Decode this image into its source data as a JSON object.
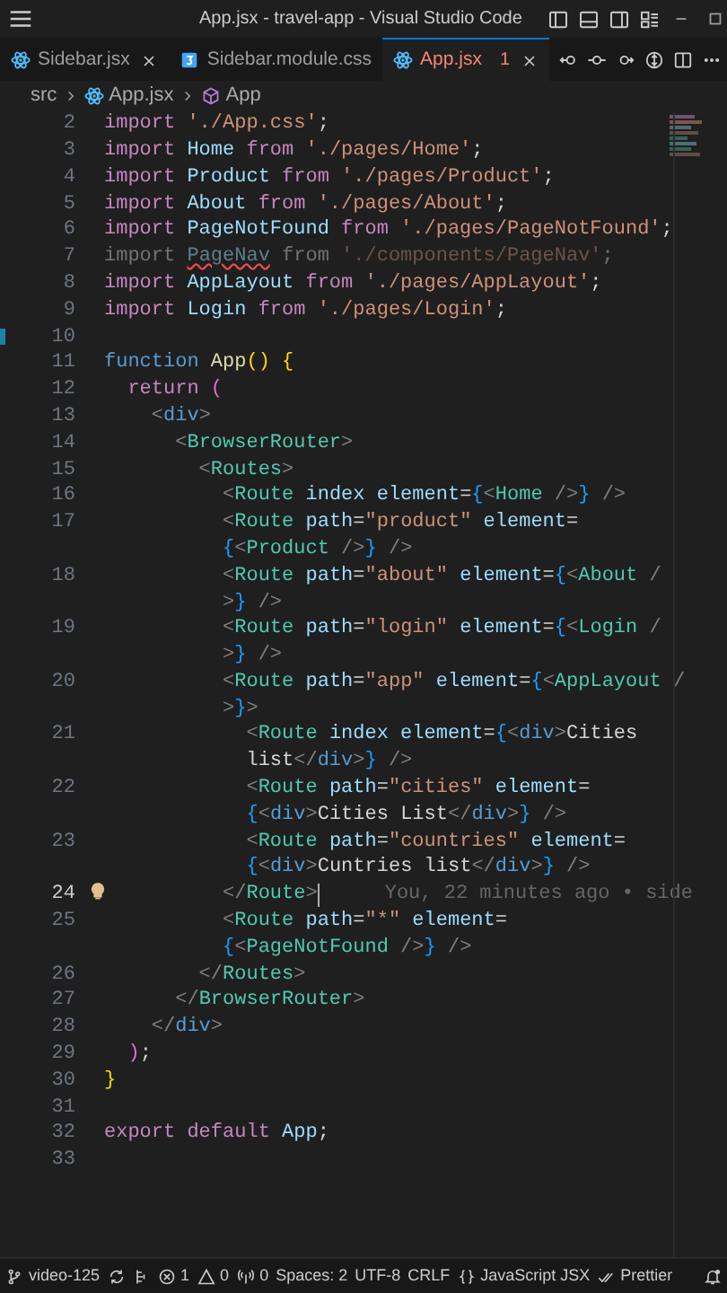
{
  "window": {
    "title": "App.jsx - travel-app - Visual Studio Code"
  },
  "tabs": [
    {
      "label": "Sidebar.jsx",
      "kind": "react",
      "selected": false,
      "close_shown": true
    },
    {
      "label": "Sidebar.module.css",
      "kind": "css",
      "selected": false,
      "close_shown": false
    },
    {
      "label": "App.jsx",
      "kind": "react",
      "selected": true,
      "close_shown": true,
      "problems": "1"
    }
  ],
  "breadcrumb": [
    {
      "label": "src",
      "kind": "folder"
    },
    {
      "label": "App.jsx",
      "kind": "react"
    },
    {
      "label": "App",
      "kind": "symbol"
    }
  ],
  "rows": [
    {
      "number": "2",
      "current": false,
      "changed": false,
      "tokens": [
        {
          "kind": "kw",
          "text": "import"
        },
        {
          "kind": "str",
          "text": " './App.css'"
        },
        {
          "kind": "plain",
          "text": ";"
        }
      ]
    },
    {
      "number": "3",
      "current": false,
      "changed": false,
      "tokens": [
        {
          "kind": "kw",
          "text": "import"
        },
        {
          "kind": "id",
          "text": " Home"
        },
        {
          "kind": "kw",
          "text": " from"
        },
        {
          "kind": "str",
          "text": " './pages/Home'"
        },
        {
          "kind": "plain",
          "text": ";"
        }
      ]
    },
    {
      "number": "4",
      "current": false,
      "changed": false,
      "tokens": [
        {
          "kind": "kw",
          "text": "import"
        },
        {
          "kind": "id",
          "text": " Product"
        },
        {
          "kind": "kw",
          "text": " from"
        },
        {
          "kind": "str",
          "text": " './pages/Product'"
        },
        {
          "kind": "plain",
          "text": ";"
        }
      ]
    },
    {
      "number": "5",
      "current": false,
      "changed": false,
      "tokens": [
        {
          "kind": "kw",
          "text": "import"
        },
        {
          "kind": "id",
          "text": " About"
        },
        {
          "kind": "kw",
          "text": " from"
        },
        {
          "kind": "str",
          "text": " './pages/About'"
        },
        {
          "kind": "plain",
          "text": ";"
        }
      ]
    },
    {
      "number": "6",
      "current": false,
      "changed": false,
      "tokens": [
        {
          "kind": "kw",
          "text": "import"
        },
        {
          "kind": "id",
          "text": " PageNotFound"
        },
        {
          "kind": "kw",
          "text": " from"
        },
        {
          "kind": "str",
          "text": " './pages/PageNotFound'"
        },
        {
          "kind": "plain",
          "text": ";"
        }
      ]
    },
    {
      "number": "7",
      "current": false,
      "changed": false,
      "tokens": [
        {
          "kind": "dim",
          "text": "import "
        },
        {
          "kind": "dimerr",
          "text": "PageNav"
        },
        {
          "kind": "dim",
          "text": " from"
        },
        {
          "kind": "dimstr",
          "text": " './components/PageNav'"
        },
        {
          "kind": "dim",
          "text": ";"
        }
      ]
    },
    {
      "number": "8",
      "current": false,
      "changed": false,
      "tokens": [
        {
          "kind": "kw",
          "text": "import"
        },
        {
          "kind": "id",
          "text": " AppLayout"
        },
        {
          "kind": "kw",
          "text": " from"
        },
        {
          "kind": "str",
          "text": " './pages/AppLayout'"
        },
        {
          "kind": "plain",
          "text": ";"
        }
      ]
    },
    {
      "number": "9",
      "current": false,
      "changed": false,
      "tokens": [
        {
          "kind": "kw",
          "text": "import"
        },
        {
          "kind": "id",
          "text": " Login"
        },
        {
          "kind": "kw",
          "text": " from"
        },
        {
          "kind": "str",
          "text": " './pages/Login'"
        },
        {
          "kind": "plain",
          "text": ";"
        }
      ]
    },
    {
      "number": "10",
      "current": false,
      "changed": true
    },
    {
      "number": "11",
      "current": false,
      "changed": false,
      "tokens": [
        {
          "kind": "fnkw",
          "text": "function"
        },
        {
          "kind": "fn",
          "text": " App"
        },
        {
          "kind": "br1",
          "text": "()"
        },
        {
          "kind": "br1",
          "text": " {"
        }
      ]
    },
    {
      "number": "12",
      "current": false,
      "changed": false,
      "tokens": [
        {
          "kind": "kw",
          "text": "  return"
        },
        {
          "kind": "br2",
          "text": " ("
        }
      ]
    },
    {
      "number": "13",
      "current": false,
      "changed": false,
      "tokens": [
        {
          "kind": "pun",
          "text": "    <"
        },
        {
          "kind": "html",
          "text": "div"
        },
        {
          "kind": "pun",
          "text": ">"
        }
      ]
    },
    {
      "number": "14",
      "current": false,
      "changed": false,
      "tokens": [
        {
          "kind": "pun",
          "text": "      <"
        },
        {
          "kind": "comp",
          "text": "BrowserRouter"
        },
        {
          "kind": "pun",
          "text": ">"
        }
      ]
    },
    {
      "number": "15",
      "current": false,
      "changed": false,
      "tokens": [
        {
          "kind": "pun",
          "text": "        <"
        },
        {
          "kind": "comp",
          "text": "Routes"
        },
        {
          "kind": "pun",
          "text": ">"
        }
      ]
    },
    {
      "number": "16",
      "current": false,
      "changed": false,
      "tokens": [
        {
          "kind": "pun",
          "text": "          <"
        },
        {
          "kind": "comp",
          "text": "Route"
        },
        {
          "kind": "attr",
          "text": " index"
        },
        {
          "kind": "attr",
          "text": " element"
        },
        {
          "kind": "plain",
          "text": "="
        },
        {
          "kind": "br3",
          "text": "{"
        },
        {
          "kind": "pun",
          "text": "<"
        },
        {
          "kind": "comp",
          "text": "Home"
        },
        {
          "kind": "pun",
          "text": " />"
        },
        {
          "kind": "br3",
          "text": "}"
        },
        {
          "kind": "pun",
          "text": " />"
        }
      ]
    },
    {
      "number": "17",
      "current": false,
      "changed": false,
      "tokens": [
        {
          "kind": "pun",
          "text": "          <"
        },
        {
          "kind": "comp",
          "text": "Route"
        },
        {
          "kind": "attr",
          "text": " path"
        },
        {
          "kind": "plain",
          "text": "="
        },
        {
          "kind": "str",
          "text": "\"product\""
        },
        {
          "kind": "attr",
          "text": " element"
        },
        {
          "kind": "plain",
          "text": "="
        }
      ]
    },
    {
      "tokens": [
        {
          "kind": "br3",
          "text": "          {"
        },
        {
          "kind": "pun",
          "text": "<"
        },
        {
          "kind": "comp",
          "text": "Product"
        },
        {
          "kind": "pun",
          "text": " />"
        },
        {
          "kind": "br3",
          "text": "}"
        },
        {
          "kind": "pun",
          "text": " />"
        }
      ]
    },
    {
      "number": "18",
      "current": false,
      "changed": false,
      "tokens": [
        {
          "kind": "pun",
          "text": "          <"
        },
        {
          "kind": "comp",
          "text": "Route"
        },
        {
          "kind": "attr",
          "text": " path"
        },
        {
          "kind": "plain",
          "text": "="
        },
        {
          "kind": "str",
          "text": "\"about\""
        },
        {
          "kind": "attr",
          "text": " element"
        },
        {
          "kind": "plain",
          "text": "="
        },
        {
          "kind": "br3",
          "text": "{"
        },
        {
          "kind": "pun",
          "text": "<"
        },
        {
          "kind": "comp",
          "text": "About"
        },
        {
          "kind": "pun",
          "text": " /"
        }
      ]
    },
    {
      "tokens": [
        {
          "kind": "pun",
          "text": "          >"
        },
        {
          "kind": "br3",
          "text": "}"
        },
        {
          "kind": "pun",
          "text": " />"
        }
      ]
    },
    {
      "number": "19",
      "current": false,
      "changed": false,
      "tokens": [
        {
          "kind": "pun",
          "text": "          <"
        },
        {
          "kind": "comp",
          "text": "Route"
        },
        {
          "kind": "attr",
          "text": " path"
        },
        {
          "kind": "plain",
          "text": "="
        },
        {
          "kind": "str",
          "text": "\"login\""
        },
        {
          "kind": "attr",
          "text": " element"
        },
        {
          "kind": "plain",
          "text": "="
        },
        {
          "kind": "br3",
          "text": "{"
        },
        {
          "kind": "pun",
          "text": "<"
        },
        {
          "kind": "comp",
          "text": "Login"
        },
        {
          "kind": "pun",
          "text": " /"
        }
      ]
    },
    {
      "tokens": [
        {
          "kind": "pun",
          "text": "          >"
        },
        {
          "kind": "br3",
          "text": "}"
        },
        {
          "kind": "pun",
          "text": " />"
        }
      ]
    },
    {
      "number": "20",
      "current": false,
      "changed": false,
      "tokens": [
        {
          "kind": "pun",
          "text": "          <"
        },
        {
          "kind": "comp",
          "text": "Route"
        },
        {
          "kind": "attr",
          "text": " path"
        },
        {
          "kind": "plain",
          "text": "="
        },
        {
          "kind": "str",
          "text": "\"app\""
        },
        {
          "kind": "attr",
          "text": " element"
        },
        {
          "kind": "plain",
          "text": "="
        },
        {
          "kind": "br3",
          "text": "{"
        },
        {
          "kind": "pun",
          "text": "<"
        },
        {
          "kind": "comp",
          "text": "AppLayout"
        },
        {
          "kind": "pun",
          "text": " /"
        }
      ]
    },
    {
      "tokens": [
        {
          "kind": "pun",
          "text": "          >"
        },
        {
          "kind": "br3",
          "text": "}"
        },
        {
          "kind": "pun",
          "text": ">"
        }
      ]
    },
    {
      "number": "21",
      "current": false,
      "changed": false,
      "tokens": [
        {
          "kind": "pun",
          "text": "            <"
        },
        {
          "kind": "comp",
          "text": "Route"
        },
        {
          "kind": "attr",
          "text": " index"
        },
        {
          "kind": "attr",
          "text": " element"
        },
        {
          "kind": "plain",
          "text": "="
        },
        {
          "kind": "br3",
          "text": "{"
        },
        {
          "kind": "pun",
          "text": "<"
        },
        {
          "kind": "html",
          "text": "div"
        },
        {
          "kind": "pun",
          "text": ">"
        },
        {
          "kind": "text",
          "text": "Cities"
        }
      ]
    },
    {
      "tokens": [
        {
          "kind": "text",
          "text": "            list"
        },
        {
          "kind": "pun",
          "text": "</"
        },
        {
          "kind": "html",
          "text": "div"
        },
        {
          "kind": "pun",
          "text": ">"
        },
        {
          "kind": "br3",
          "text": "}"
        },
        {
          "kind": "pun",
          "text": " />"
        }
      ]
    },
    {
      "number": "22",
      "current": false,
      "changed": false,
      "tokens": [
        {
          "kind": "pun",
          "text": "            <"
        },
        {
          "kind": "comp",
          "text": "Route"
        },
        {
          "kind": "attr",
          "text": " path"
        },
        {
          "kind": "plain",
          "text": "="
        },
        {
          "kind": "str",
          "text": "\"cities\""
        },
        {
          "kind": "attr",
          "text": " element"
        },
        {
          "kind": "plain",
          "text": "="
        }
      ]
    },
    {
      "tokens": [
        {
          "kind": "br3",
          "text": "            {"
        },
        {
          "kind": "pun",
          "text": "<"
        },
        {
          "kind": "html",
          "text": "div"
        },
        {
          "kind": "pun",
          "text": ">"
        },
        {
          "kind": "text",
          "text": "Cities List"
        },
        {
          "kind": "pun",
          "text": "</"
        },
        {
          "kind": "html",
          "text": "div"
        },
        {
          "kind": "pun",
          "text": ">"
        },
        {
          "kind": "br3",
          "text": "}"
        },
        {
          "kind": "pun",
          "text": " />"
        }
      ]
    },
    {
      "number": "23",
      "current": false,
      "changed": false,
      "tokens": [
        {
          "kind": "pun",
          "text": "            <"
        },
        {
          "kind": "comp",
          "text": "Route"
        },
        {
          "kind": "attr",
          "text": " path"
        },
        {
          "kind": "plain",
          "text": "="
        },
        {
          "kind": "str",
          "text": "\"countries\""
        },
        {
          "kind": "attr",
          "text": " element"
        },
        {
          "kind": "plain",
          "text": "="
        }
      ]
    },
    {
      "tokens": [
        {
          "kind": "br3",
          "text": "            {"
        },
        {
          "kind": "pun",
          "text": "<"
        },
        {
          "kind": "html",
          "text": "div"
        },
        {
          "kind": "pun",
          "text": ">"
        },
        {
          "kind": "text",
          "text": "Cuntries list"
        },
        {
          "kind": "pun",
          "text": "</"
        },
        {
          "kind": "html",
          "text": "div"
        },
        {
          "kind": "pun",
          "text": ">"
        },
        {
          "kind": "br3",
          "text": "}"
        },
        {
          "kind": "pun",
          "text": " />"
        }
      ]
    },
    {
      "number": "24",
      "current": true,
      "changed": false,
      "tokens": [
        {
          "kind": "pun",
          "text": "          </"
        },
        {
          "kind": "comp",
          "text": "Route"
        },
        {
          "kind": "pun",
          "text": ">"
        }
      ],
      "blame": "You, 22 minutes ago • side"
    },
    {
      "number": "25",
      "current": false,
      "changed": false,
      "tokens": [
        {
          "kind": "pun",
          "text": "          <"
        },
        {
          "kind": "comp",
          "text": "Route"
        },
        {
          "kind": "attr",
          "text": " path"
        },
        {
          "kind": "plain",
          "text": "="
        },
        {
          "kind": "str",
          "text": "\"*\""
        },
        {
          "kind": "attr",
          "text": " element"
        },
        {
          "kind": "plain",
          "text": "="
        }
      ]
    },
    {
      "tokens": [
        {
          "kind": "br3",
          "text": "          {"
        },
        {
          "kind": "pun",
          "text": "<"
        },
        {
          "kind": "comp",
          "text": "PageNotFound"
        },
        {
          "kind": "pun",
          "text": " />"
        },
        {
          "kind": "br3",
          "text": "}"
        },
        {
          "kind": "pun",
          "text": " />"
        }
      ]
    },
    {
      "number": "26",
      "current": false,
      "changed": false,
      "tokens": [
        {
          "kind": "pun",
          "text": "        </"
        },
        {
          "kind": "comp",
          "text": "Routes"
        },
        {
          "kind": "pun",
          "text": ">"
        }
      ]
    },
    {
      "number": "27",
      "current": false,
      "changed": false,
      "tokens": [
        {
          "kind": "pun",
          "text": "      </"
        },
        {
          "kind": "comp",
          "text": "BrowserRouter"
        },
        {
          "kind": "pun",
          "text": ">"
        }
      ]
    },
    {
      "number": "28",
      "current": false,
      "changed": false,
      "tokens": [
        {
          "kind": "pun",
          "text": "    </"
        },
        {
          "kind": "html",
          "text": "div"
        },
        {
          "kind": "pun",
          "text": ">"
        }
      ]
    },
    {
      "number": "29",
      "current": false,
      "changed": false,
      "tokens": [
        {
          "kind": "br2",
          "text": "  )"
        },
        {
          "kind": "plain",
          "text": ";"
        }
      ]
    },
    {
      "number": "30",
      "current": false,
      "changed": false,
      "tokens": [
        {
          "kind": "br1",
          "text": "}"
        }
      ]
    },
    {
      "number": "31",
      "current": false,
      "changed": false
    },
    {
      "number": "32",
      "current": false,
      "changed": false,
      "tokens": [
        {
          "kind": "kw",
          "text": "export"
        },
        {
          "kind": "kw",
          "text": " default"
        },
        {
          "kind": "id",
          "text": " App"
        },
        {
          "kind": "plain",
          "text": ";"
        }
      ]
    },
    {
      "number": "33",
      "current": false,
      "changed": false
    }
  ],
  "status_bar": [
    {
      "kind": "branch",
      "text": "video-125"
    },
    {
      "kind": "sync"
    },
    {
      "kind": "remote"
    },
    {
      "kind": "errors",
      "text": "1"
    },
    {
      "kind": "warnings",
      "text": "0"
    },
    {
      "kind": "ports",
      "text": "0"
    },
    {
      "kind": "plain",
      "text": "Spaces: 2"
    },
    {
      "kind": "plain",
      "text": "UTF-8"
    },
    {
      "kind": "plain",
      "text": "CRLF"
    },
    {
      "kind": "language",
      "text": "JavaScript JSX"
    },
    {
      "kind": "prettier",
      "text": "Prettier"
    },
    {
      "kind": "bell"
    }
  ]
}
